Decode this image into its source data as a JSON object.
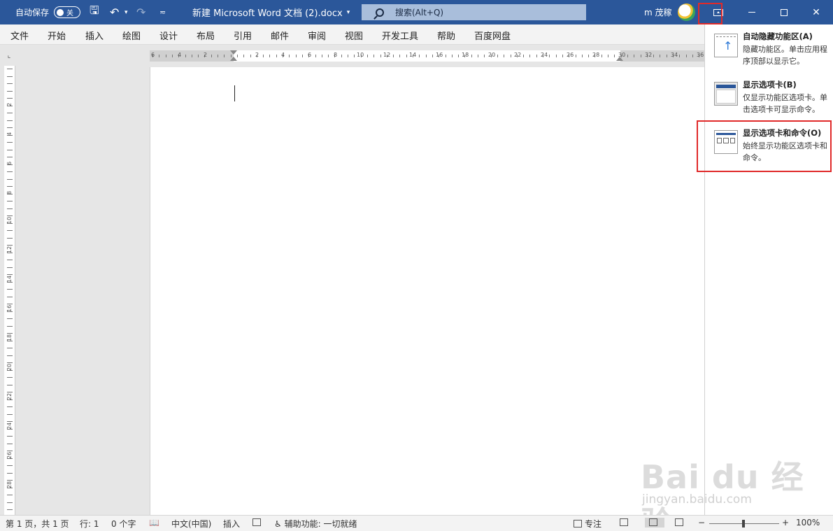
{
  "titlebar": {
    "autosave_label": "自动保存",
    "autosave_state": "关",
    "doc_title": "新建 Microsoft Word 文档 (2).docx",
    "search_placeholder": "搜索(Alt+Q)",
    "user_name": "m 茂稼",
    "accent": "#2b579a"
  },
  "menu": {
    "tabs": [
      "文件",
      "开始",
      "插入",
      "绘图",
      "设计",
      "布局",
      "引用",
      "邮件",
      "审阅",
      "视图",
      "开发工具",
      "帮助",
      "百度网盘"
    ]
  },
  "ruler": {
    "h_labels": [
      "6",
      "4",
      "2",
      "2",
      "4",
      "6",
      "8",
      "10",
      "12",
      "14",
      "16",
      "18",
      "20",
      "22",
      "24",
      "26",
      "28",
      "30",
      "32",
      "34",
      "36"
    ],
    "v_labels": [
      "2",
      "4",
      "6",
      "8",
      "10",
      "12",
      "14",
      "16",
      "18",
      "20",
      "22",
      "24",
      "26",
      "28"
    ]
  },
  "dropdown": {
    "options": [
      {
        "title": "自动隐藏功能区(A)",
        "desc1": "隐藏功能区。单击应用程",
        "desc2": "序顶部以显示它。",
        "icon": "auto-hide-ribbon-icon"
      },
      {
        "title": "显示选项卡(B)",
        "desc1": "仅显示功能区选项卡。单",
        "desc2": "击选项卡可显示命令。",
        "icon": "show-tabs-icon"
      },
      {
        "title": "显示选项卡和命令(O)",
        "desc1": "始终显示功能区选项卡和",
        "desc2": "命令。",
        "icon": "show-tabs-commands-icon"
      }
    ]
  },
  "status": {
    "page": "第 1 页，共 1 页",
    "line": "行: 1",
    "words": "0 个字",
    "language": "中文(中国)",
    "mode": "插入",
    "accessibility": "辅助功能: 一切就绪",
    "focus": "专注",
    "zoom_minus": "−",
    "zoom_plus": "+",
    "zoom": "100%"
  },
  "watermark": {
    "big": "Bai du 经验",
    "small": "jingyan.baidu.com"
  }
}
